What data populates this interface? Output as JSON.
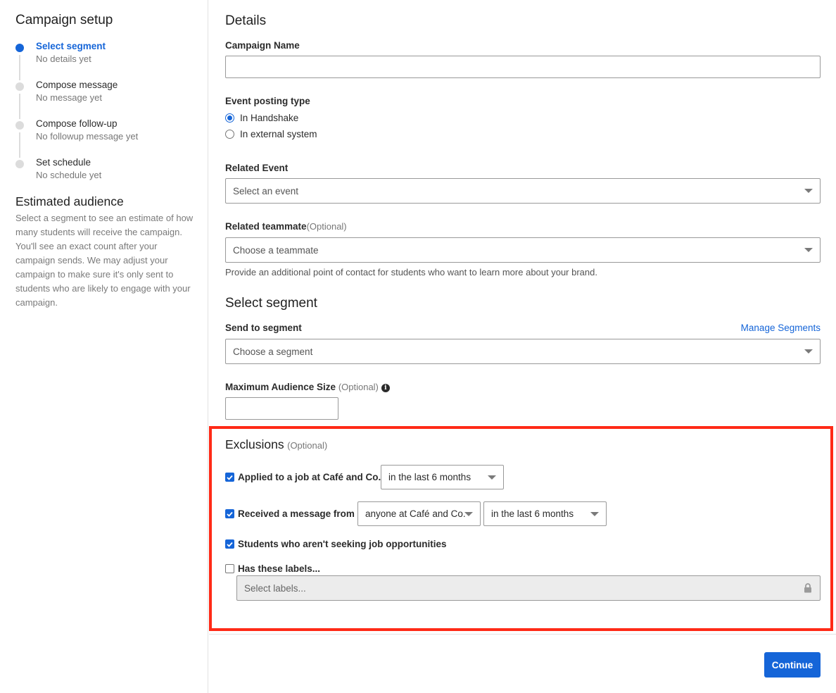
{
  "sidebar": {
    "title": "Campaign setup",
    "steps": [
      {
        "label": "Select segment",
        "sub": "No details yet"
      },
      {
        "label": "Compose message",
        "sub": "No message yet"
      },
      {
        "label": "Compose follow-up",
        "sub": "No followup message yet"
      },
      {
        "label": "Set schedule",
        "sub": "No schedule yet"
      }
    ],
    "estimated_audience": {
      "title": "Estimated audience",
      "text": "Select a segment to see an estimate of how many students will receive the campaign. You'll see an exact count after your campaign sends. We may adjust your campaign to make sure it's only sent to students who are likely to engage with your campaign."
    }
  },
  "details": {
    "title": "Details",
    "campaign_name_label": "Campaign Name",
    "campaign_name_value": "",
    "event_posting_type_label": "Event posting type",
    "event_posting_options": [
      "In Handshake",
      "In external system"
    ],
    "event_posting_selected": "In Handshake",
    "related_event_label": "Related Event",
    "related_event_placeholder": "Select an event",
    "related_teammate_label": "Related teammate",
    "related_teammate_optional": "(Optional)",
    "related_teammate_placeholder": "Choose a teammate",
    "related_teammate_help": "Provide an additional point of contact for students who want to learn more about your brand."
  },
  "segment": {
    "title": "Select segment",
    "send_to_label": "Send to segment",
    "manage_link": "Manage Segments",
    "segment_placeholder": "Choose a segment",
    "max_audience_label": "Maximum Audience Size",
    "max_audience_optional": "(Optional)",
    "max_audience_value": ""
  },
  "exclusions": {
    "title": "Exclusions",
    "optional": "(Optional)",
    "applied_label": "Applied to a job at Café and Co.",
    "applied_checked": true,
    "applied_period": "in the last 6 months",
    "received_label": "Received a message from",
    "received_checked": true,
    "received_from": "anyone at Café and Co.",
    "received_period": "in the last 6 months",
    "not_seeking_label": "Students who aren't seeking job opportunities",
    "not_seeking_checked": true,
    "labels_label": "Has these labels...",
    "labels_checked": false,
    "labels_placeholder": "Select labels..."
  },
  "footer": {
    "continue_label": "Continue"
  },
  "colors": {
    "accent": "#1565d8",
    "highlight": "#ff2a17"
  }
}
